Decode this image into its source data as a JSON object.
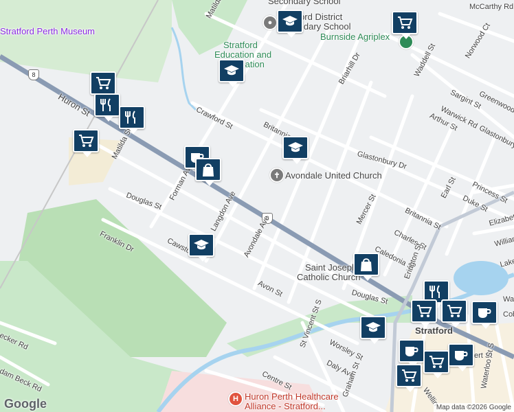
{
  "colors": {
    "background": "#eef0f2",
    "road": "#ffffff",
    "highway": "#8a9bb3",
    "park": "#c9e8c9",
    "water": "#a6d3ef",
    "pin": "#123f63",
    "hospital_area": "#f7dede",
    "sports_field": "#f3ecd6"
  },
  "poi_labels": {
    "museum": "Stratford Perth Museum",
    "district_school_1": "Stratford District",
    "district_school_2": "Secondary School",
    "top_school": "Secondary School",
    "education_1": "Stratford",
    "education_2": "Education and",
    "education_3": "Recreation",
    "agriplex": "Burnside Agriplex",
    "church": "Avondale United Church",
    "joseph_1": "Saint Joseph",
    "joseph_2": "Catholic Church",
    "hospital_1": "Huron Perth Healthcare",
    "hospital_2": "Alliance - Stratford...",
    "downtown": "Stratford"
  },
  "street_labels": {
    "mccarthy": "McCarthy Rd",
    "matilda_top": "Matilda St",
    "huron": "Huron St",
    "crawford": "Crawford St",
    "britannia_top": "Britannia St",
    "briarhill": "Briarhill Dr",
    "waddell": "Waddell St",
    "norwood": "Norwood Ct",
    "sargint": "Sargint St",
    "greenwood": "Greenwood",
    "warwick": "Warwick Rd",
    "arthur": "Arthur St",
    "glastonbury_1": "Glastonbury Dr",
    "glastonbury_2": "Glastonbury",
    "matilda_bottom": "Matilda St",
    "forman": "Forman Ave",
    "douglas_left": "Douglas St",
    "franklin": "Franklin Dr",
    "cawston": "Cawston",
    "langdon": "Langdon Ave",
    "avondale": "Avondale Ave",
    "princess": "Princess St",
    "earl": "Earl St",
    "duke": "Duke St",
    "britannia_right": "Britannia St",
    "mercer": "Mercer St",
    "charles": "Charles St",
    "elizabeth": "Elizabeth",
    "caledonia": "Caledonia St",
    "erington": "Erington St",
    "william": "William",
    "lake": "Lake",
    "avon": "Avon St",
    "douglas_right": "Douglas St",
    "wat": "Wat",
    "cob": "Cob",
    "st_vincent": "St Vincent St S",
    "worsley": "Worsley St",
    "daly": "Daly Ave",
    "centre": "Centre St",
    "graham": "Graham St",
    "ert": "ert St",
    "waterloo": "Waterloo St S",
    "wellington": "Wellin",
    "becker": "ecker Rd",
    "beck": "dam Beck Rd"
  },
  "highway_shield": "8",
  "hospital_marker": "H",
  "icon_names": [
    "shopping-cart-icon",
    "restaurant-icon",
    "school-icon",
    "shopping-bag-icon",
    "coffee-icon",
    "place-of-worship-icon",
    "hospital-icon"
  ],
  "logo": "Google",
  "attribution": "Map data ©2026 Google"
}
